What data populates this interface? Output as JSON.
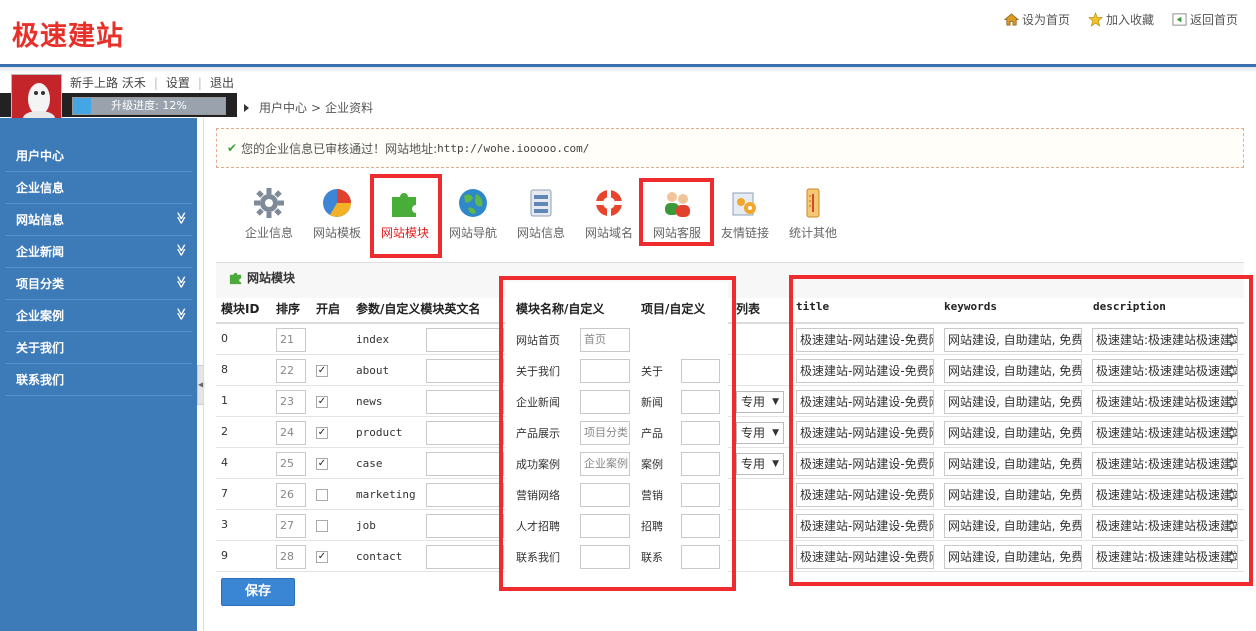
{
  "app": {
    "logo": "极速建站"
  },
  "top_links": [
    {
      "label": "设为首页",
      "icon": "home-icon"
    },
    {
      "label": "加入收藏",
      "icon": "star-icon"
    },
    {
      "label": "返回首页",
      "icon": "back-icon"
    }
  ],
  "user": {
    "name": "新手上路 沃禾",
    "settings": "设置",
    "logout": "退出",
    "progress_label": "升级进度: 12%",
    "progress_value": 12
  },
  "breadcrumb": [
    "用户中心",
    "企业资料"
  ],
  "sidebar": {
    "items": [
      {
        "label": "用户中心",
        "expandable": false
      },
      {
        "label": "企业信息",
        "expandable": false
      },
      {
        "label": "网站信息",
        "expandable": true
      },
      {
        "label": "企业新闻",
        "expandable": true
      },
      {
        "label": "项目分类",
        "expandable": true
      },
      {
        "label": "企业案例",
        "expandable": true
      },
      {
        "label": "关于我们",
        "expandable": false
      },
      {
        "label": "联系我们",
        "expandable": false
      }
    ],
    "chevron": "»"
  },
  "notice": {
    "check": "✔",
    "text": "您的企业信息已审核通过！网站地址:",
    "url": "http://wohe.iooooo.com/"
  },
  "tools": [
    {
      "label": "企业信息",
      "icon": "gear-icon"
    },
    {
      "label": "网站模板",
      "icon": "pie-chart-icon"
    },
    {
      "label": "网站模块",
      "icon": "puzzle-icon",
      "active": true
    },
    {
      "label": "网站导航",
      "icon": "globe-icon"
    },
    {
      "label": "网站信息",
      "icon": "database-icon"
    },
    {
      "label": "网站域名",
      "icon": "lifebuoy-icon"
    },
    {
      "label": "网站客服",
      "icon": "users-icon"
    },
    {
      "label": "友情链接",
      "icon": "link-gears-icon"
    },
    {
      "label": "统计其他",
      "icon": "thermometer-icon"
    }
  ],
  "panel": {
    "title": "网站模块"
  },
  "table": {
    "headers": {
      "id": "模块ID",
      "order": "排序",
      "enabled": "开启",
      "param": "参数/自定义模块英文名",
      "name": "模块名称/自定义",
      "item": "项目/自定义",
      "list": "列表",
      "title": "title",
      "keywords": "keywords",
      "description": "description"
    },
    "rows": [
      {
        "id": "0",
        "order": "21",
        "enabled": false,
        "show_check": false,
        "param": "index",
        "name": "网站首页",
        "name_custom": "首页",
        "item": "",
        "item_custom": "",
        "list": "",
        "title": "极速建站-网站建设-免费网",
        "keywords": "网站建设, 自助建站, 免费网",
        "description": "极速建站:极速建站极速建站"
      },
      {
        "id": "8",
        "order": "22",
        "enabled": true,
        "show_check": true,
        "param": "about",
        "name": "关于我们",
        "name_custom": "",
        "item": "关于",
        "item_custom": "",
        "list": "",
        "title": "极速建站-网站建设-免费网",
        "keywords": "网站建设, 自助建站, 免费网",
        "description": "极速建站:极速建站极速建站"
      },
      {
        "id": "1",
        "order": "23",
        "enabled": true,
        "show_check": true,
        "param": "news",
        "name": "企业新闻",
        "name_custom": "",
        "item": "新闻",
        "item_custom": "",
        "list": "专用",
        "title": "极速建站-网站建设-免费网",
        "keywords": "网站建设, 自助建站, 免费网",
        "description": "极速建站:极速建站极速建站"
      },
      {
        "id": "2",
        "order": "24",
        "enabled": true,
        "show_check": true,
        "param": "product",
        "name": "产品展示",
        "name_custom": "项目分类",
        "item": "产品",
        "item_custom": "",
        "list": "专用",
        "title": "极速建站-网站建设-免费网",
        "keywords": "网站建设, 自助建站, 免费网",
        "description": "极速建站:极速建站极速建站"
      },
      {
        "id": "4",
        "order": "25",
        "enabled": true,
        "show_check": true,
        "param": "case",
        "name": "成功案例",
        "name_custom": "企业案例",
        "item": "案例",
        "item_custom": "",
        "list": "专用",
        "title": "极速建站-网站建设-免费网",
        "keywords": "网站建设, 自助建站, 免费网",
        "description": "极速建站:极速建站极速建站"
      },
      {
        "id": "7",
        "order": "26",
        "enabled": false,
        "show_check": true,
        "param": "marketing",
        "name": "营销网络",
        "name_custom": "",
        "item": "营销",
        "item_custom": "",
        "list": "",
        "title": "极速建站-网站建设-免费网",
        "keywords": "网站建设, 自助建站, 免费网",
        "description": "极速建站:极速建站极速建站"
      },
      {
        "id": "3",
        "order": "27",
        "enabled": false,
        "show_check": true,
        "param": "job",
        "name": "人才招聘",
        "name_custom": "",
        "item": "招聘",
        "item_custom": "",
        "list": "",
        "title": "极速建站-网站建设-免费网",
        "keywords": "网站建设, 自助建站, 免费网",
        "description": "极速建站:极速建站极速建站"
      },
      {
        "id": "9",
        "order": "28",
        "enabled": true,
        "show_check": true,
        "param": "contact",
        "name": "联系我们",
        "name_custom": "",
        "item": "联系",
        "item_custom": "",
        "list": "",
        "title": "极速建站-网站建设-免费网",
        "keywords": "网站建设, 自助建站, 免费网",
        "description": "极速建站:极速建站极速建站"
      }
    ]
  },
  "save_label": "保存",
  "colors": {
    "brand_red": "#e8302a",
    "sidebar_blue": "#3d7ab8",
    "highlight_red": "#ee2b2f",
    "button_blue": "#3a86d4"
  }
}
